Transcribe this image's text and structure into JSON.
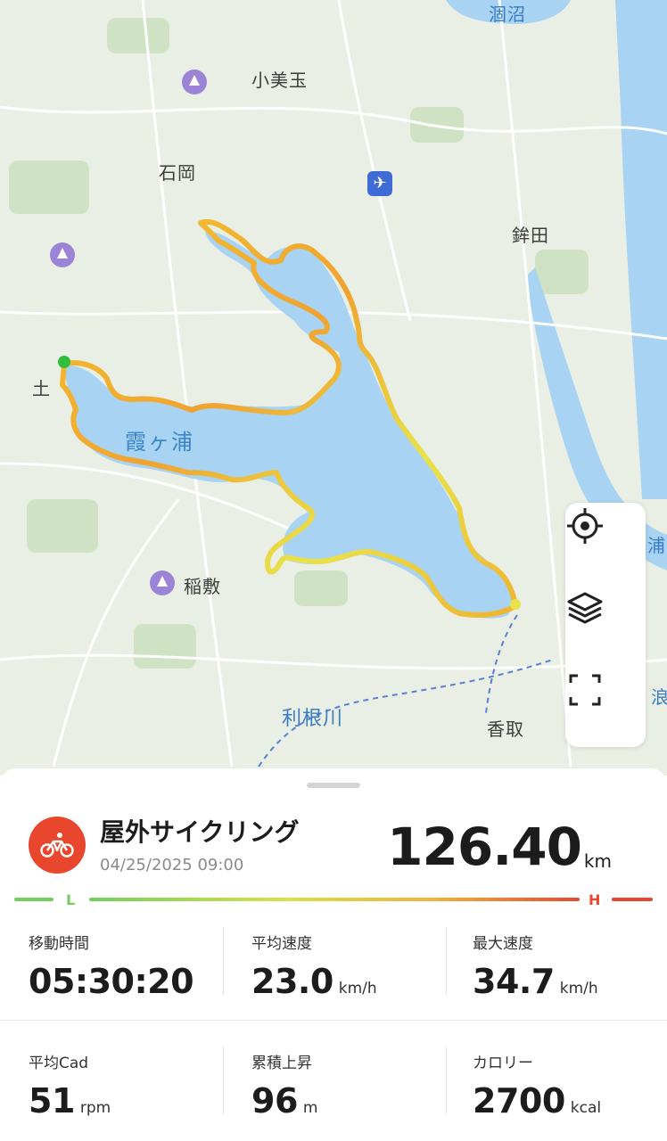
{
  "map": {
    "places": [
      {
        "name": "涸沼",
        "kind": "water"
      },
      {
        "name": "小美玉",
        "kind": "town"
      },
      {
        "name": "石岡",
        "kind": "town"
      },
      {
        "name": "鉾田",
        "kind": "town"
      },
      {
        "name": "土",
        "kind": "town"
      },
      {
        "name": "稲敷",
        "kind": "town"
      },
      {
        "name": "香取",
        "kind": "town"
      },
      {
        "name": "浦",
        "kind": "water"
      },
      {
        "name": "浪",
        "kind": "water"
      }
    ],
    "lake_label": "霞ヶ浦",
    "river_label": "利根川",
    "poi_icons": [
      "park-icon",
      "park-icon",
      "park-icon",
      "airport-icon"
    ],
    "route_start_color": "#2fbf3a",
    "route_end_color": "#e8472d",
    "water_color": "#a8d3f2"
  },
  "controls": {
    "icons": [
      "locate-icon",
      "layers-icon",
      "fullscreen-icon"
    ]
  },
  "activity": {
    "title": "屋外サイクリング",
    "date": "04/25/2025 09:00",
    "distance": "126.40",
    "distance_unit": "km",
    "sport_icon": "bicycle-icon",
    "accent_color": "#e8472d"
  },
  "legend": {
    "low_label": "L",
    "high_label": "H",
    "low_color": "#6fd15a",
    "high_color": "#e8472d"
  },
  "stats": [
    {
      "label": "移動時間",
      "value": "05:30:20",
      "unit": ""
    },
    {
      "label": "平均速度",
      "value": "23.0",
      "unit": "km/h"
    },
    {
      "label": "最大速度",
      "value": "34.7",
      "unit": "km/h"
    },
    {
      "label": "平均Cad",
      "value": "51",
      "unit": "rpm"
    },
    {
      "label": "累積上昇",
      "value": "96",
      "unit": "m"
    },
    {
      "label": "カロリー",
      "value": "2700",
      "unit": "kcal"
    }
  ]
}
